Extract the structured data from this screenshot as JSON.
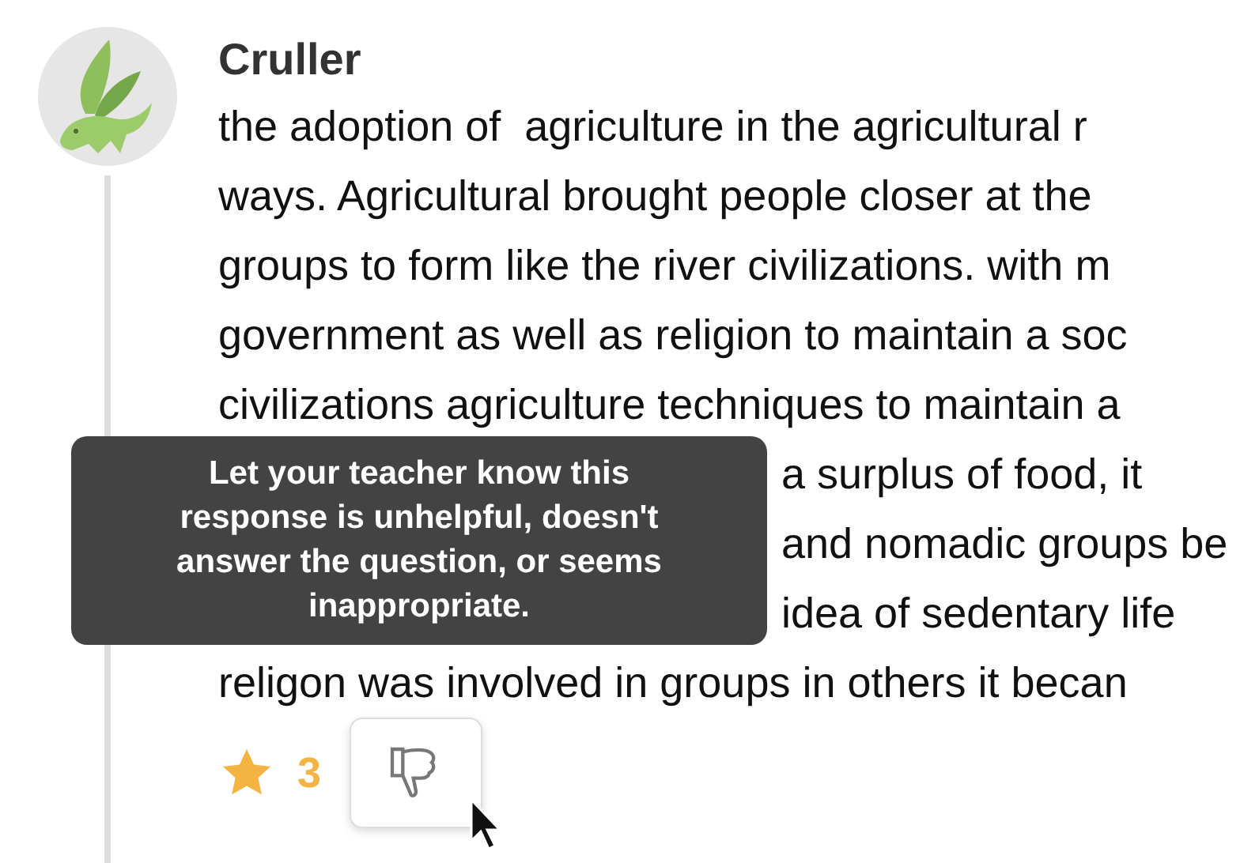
{
  "post": {
    "author": "Cruller",
    "lines": [
      {
        "kind": "full",
        "text": "the adoption of  agriculture in the agricultural r"
      },
      {
        "kind": "full",
        "text": "ways. Agricultural brought people closer at the"
      },
      {
        "kind": "full",
        "text": "groups to form like the river civilizations. with m"
      },
      {
        "kind": "full",
        "text": "government as well as religion to maintain a soc"
      },
      {
        "kind": "full",
        "text": "civilizations agriculture techniques to maintain a"
      },
      {
        "kind": "tail",
        "text": "a surplus of food, it"
      },
      {
        "kind": "tail",
        "text": "and nomadic groups be"
      },
      {
        "kind": "tail",
        "text": "idea of sedentary life"
      },
      {
        "kind": "full",
        "text": "religon was involved in groups in others it becan"
      }
    ],
    "star_count": "3"
  },
  "tooltip": {
    "text": "Let your teacher know this response is unhelpful, doesn't answer the question, or seems inappropriate."
  }
}
